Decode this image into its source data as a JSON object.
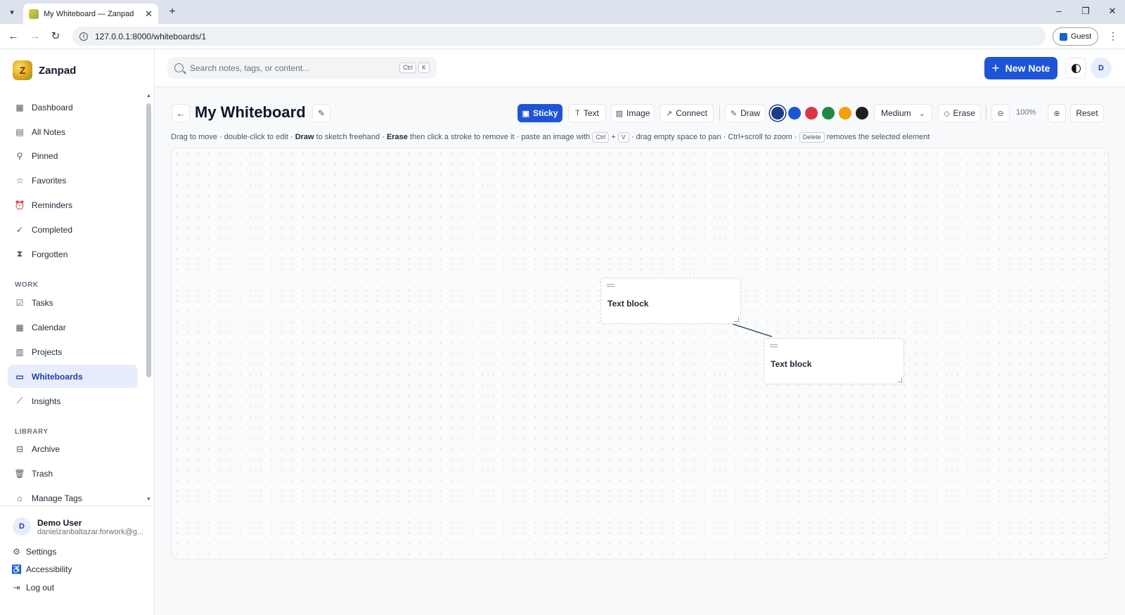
{
  "browser": {
    "tab_title": "My Whiteboard — Zanpad",
    "url": "127.0.0.1:8000/whiteboards/1",
    "profile_label": "Guest"
  },
  "app": {
    "name": "Zanpad",
    "search_placeholder": "Search notes, tags, or content...",
    "search_kbd": [
      "Ctrl",
      "K"
    ],
    "new_note_label": "New Note",
    "avatar_initial": "D"
  },
  "sidebar": {
    "main_items": [
      {
        "label": "Dashboard",
        "icon": "dashboard-icon"
      },
      {
        "label": "All Notes",
        "icon": "notes-icon"
      },
      {
        "label": "Pinned",
        "icon": "pin-icon"
      },
      {
        "label": "Favorites",
        "icon": "star-icon"
      },
      {
        "label": "Reminders",
        "icon": "alarm-icon"
      },
      {
        "label": "Completed",
        "icon": "check-circle-icon"
      },
      {
        "label": "Forgotten",
        "icon": "hourglass-icon"
      }
    ],
    "work_label": "WORK",
    "work_items": [
      {
        "label": "Tasks",
        "icon": "task-icon"
      },
      {
        "label": "Calendar",
        "icon": "calendar-icon"
      },
      {
        "label": "Projects",
        "icon": "kanban-icon"
      },
      {
        "label": "Whiteboards",
        "icon": "whiteboard-icon",
        "active": true
      },
      {
        "label": "Insights",
        "icon": "chart-line-icon"
      }
    ],
    "library_label": "LIBRARY",
    "library_items": [
      {
        "label": "Archive",
        "icon": "archive-icon"
      },
      {
        "label": "Trash",
        "icon": "trash-icon"
      },
      {
        "label": "Manage Tags",
        "icon": "tag-icon"
      }
    ],
    "user": {
      "initial": "D",
      "name": "Demo User",
      "email": "danielzanbaltazar.forwork@g..."
    },
    "footer": {
      "settings": "Settings",
      "accessibility": "Accessibility",
      "logout": "Log out"
    }
  },
  "whiteboard": {
    "title": "My Whiteboard",
    "tools": {
      "sticky": "Sticky",
      "text": "Text",
      "image": "Image",
      "connect": "Connect",
      "draw": "Draw",
      "erase": "Erase",
      "reset": "Reset"
    },
    "active_tool": "sticky",
    "colors": [
      "#1e3a8a",
      "#1d55d6",
      "#dc3545",
      "#1e8a4a",
      "#f59e0b",
      "#1f1f1f"
    ],
    "selected_color": "#1e3a8a",
    "stroke_size": "Medium",
    "zoom": "100%",
    "hint": {
      "p1": "Drag to move · double-click to edit · ",
      "draw": "Draw",
      "p2": " to sketch freehand · ",
      "erase": "Erase",
      "p3": " then click a stroke to remove it · paste an image with ",
      "kbd_ctrl": "Ctrl",
      "plus": "+",
      "kbd_v": "V",
      "p4": " · drag empty space to pan · Ctrl+scroll to zoom · ",
      "kbd_delete": "Delete",
      "p5": " removes the selected element"
    },
    "blocks": [
      {
        "text": "Text block"
      },
      {
        "text": "Text block"
      }
    ]
  },
  "colors": {
    "accent": "#1d55d6",
    "sidebar_active_bg": "#e7edfc"
  }
}
